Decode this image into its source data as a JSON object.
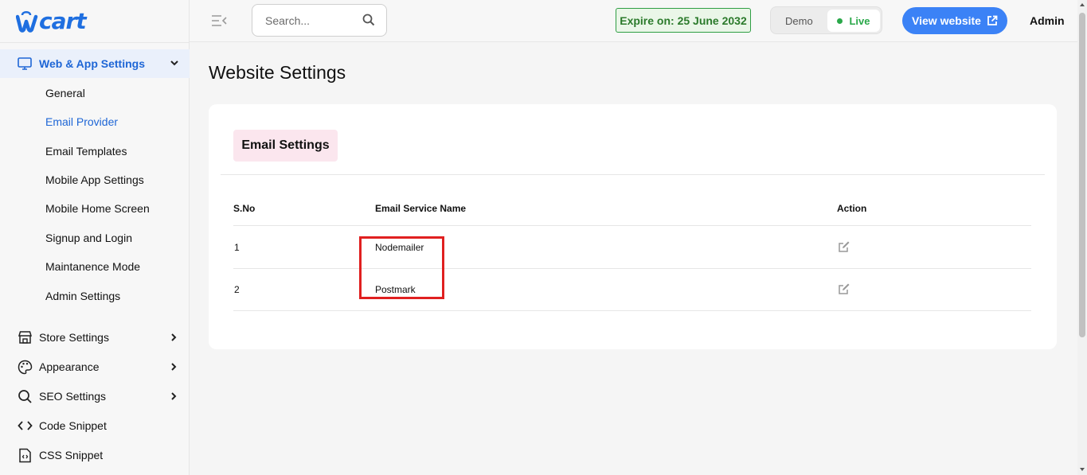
{
  "app": {
    "logo_text": "cart"
  },
  "sidebar": {
    "group": {
      "label": "Web & App Settings",
      "icon": "monitor-icon"
    },
    "sub_items": [
      {
        "label": "General",
        "active": false
      },
      {
        "label": "Email Provider",
        "active": true
      },
      {
        "label": "Email Templates",
        "active": false
      },
      {
        "label": "Mobile App Settings",
        "active": false
      },
      {
        "label": "Mobile Home Screen",
        "active": false
      },
      {
        "label": "Signup and Login",
        "active": false
      },
      {
        "label": "Maintanence Mode",
        "active": false
      },
      {
        "label": "Admin Settings",
        "active": false
      }
    ],
    "items": [
      {
        "label": "Store Settings",
        "icon": "store-icon",
        "has_chevron": true
      },
      {
        "label": "Appearance",
        "icon": "palette-icon",
        "has_chevron": true
      },
      {
        "label": "SEO Settings",
        "icon": "search-icon",
        "has_chevron": true
      },
      {
        "label": "Code Snippet",
        "icon": "code-icon",
        "has_chevron": false
      },
      {
        "label": "CSS Snippet",
        "icon": "file-code-icon",
        "has_chevron": false
      }
    ]
  },
  "header": {
    "search_placeholder": "Search...",
    "expire_text": "Expire on: 25 June 2032",
    "mode_demo": "Demo",
    "mode_live": "Live",
    "view_website": "View website",
    "user": "Admin"
  },
  "main": {
    "page_title": "Website Settings",
    "tab_label": "Email Settings",
    "table": {
      "headers": {
        "sno": "S.No",
        "name": "Email Service Name",
        "action": "Action"
      },
      "rows": [
        {
          "sno": "1",
          "name": "Nodemailer"
        },
        {
          "sno": "2",
          "name": "Postmark"
        }
      ]
    }
  },
  "colors": {
    "accent": "#1e66d6",
    "button": "#3b82f6",
    "live": "#2aa84a",
    "tab_bg": "#fbe6ee",
    "highlight": "#e02020"
  }
}
